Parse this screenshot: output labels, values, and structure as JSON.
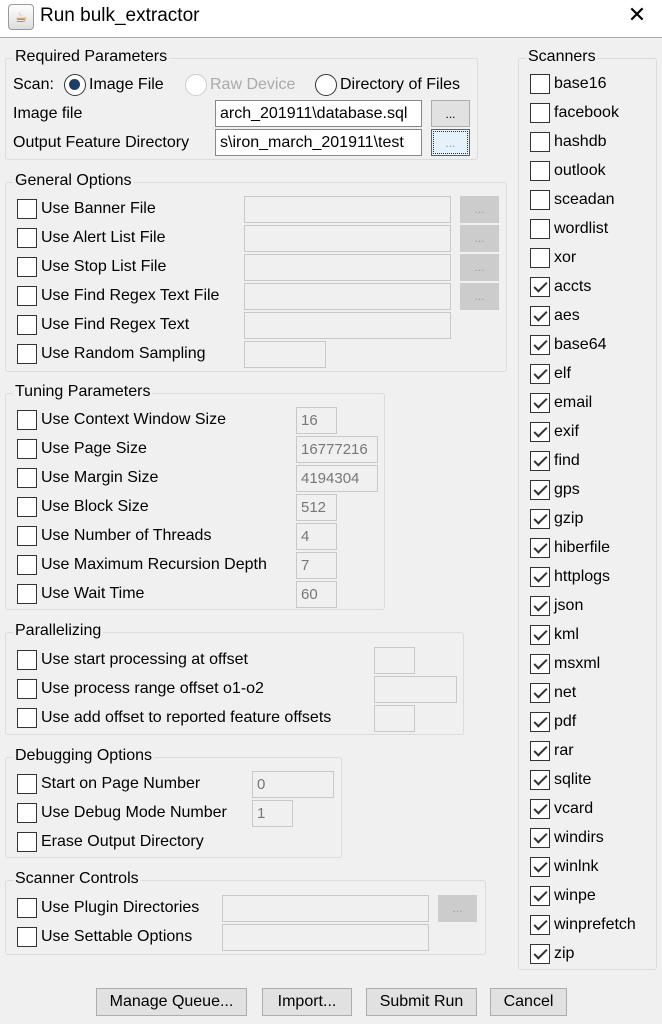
{
  "window": {
    "title": "Run bulk_extractor",
    "close": "✕"
  },
  "required": {
    "title": "Required Parameters",
    "scan_label": "Scan:",
    "scan_options": [
      {
        "label": "Image File",
        "selected": true,
        "enabled": true
      },
      {
        "label": "Raw Device",
        "selected": false,
        "enabled": false
      },
      {
        "label": "Directory of Files",
        "selected": false,
        "enabled": true
      }
    ],
    "image_file_label": "Image file",
    "image_file_value": "arch_201911\\database.sql",
    "output_label": "Output Feature Directory",
    "output_value": "s\\iron_march_201911\\test",
    "browse": "..."
  },
  "general": {
    "title": "General Options",
    "items": [
      {
        "label": "Use Banner File",
        "value": "",
        "browse": "..."
      },
      {
        "label": "Use Alert List File",
        "value": "",
        "browse": "..."
      },
      {
        "label": "Use Stop List File",
        "value": "",
        "browse": "..."
      },
      {
        "label": "Use Find Regex Text File",
        "value": "",
        "browse": "..."
      },
      {
        "label": "Use Find Regex Text",
        "value": ""
      },
      {
        "label": "Use Random Sampling",
        "value": ""
      }
    ]
  },
  "tuning": {
    "title": "Tuning Parameters",
    "items": [
      {
        "label": "Use Context Window Size",
        "value": "16"
      },
      {
        "label": "Use Page Size",
        "value": "16777216"
      },
      {
        "label": "Use Margin Size",
        "value": "4194304"
      },
      {
        "label": "Use Block Size",
        "value": "512"
      },
      {
        "label": "Use Number of Threads",
        "value": "4"
      },
      {
        "label": "Use Maximum Recursion Depth",
        "value": "7"
      },
      {
        "label": "Use Wait Time",
        "value": "60"
      }
    ]
  },
  "parallel": {
    "title": "Parallelizing",
    "items": [
      {
        "label": "Use start processing at offset",
        "value": ""
      },
      {
        "label": "Use process range offset o1-o2",
        "value": ""
      },
      {
        "label": "Use add offset to reported feature offsets",
        "value": ""
      }
    ]
  },
  "debug": {
    "title": "Debugging Options",
    "items": [
      {
        "label": "Start on Page Number",
        "value": "0"
      },
      {
        "label": "Use Debug Mode Number",
        "value": "1"
      },
      {
        "label": "Erase Output Directory"
      }
    ]
  },
  "controls": {
    "title": "Scanner Controls",
    "items": [
      {
        "label": "Use Plugin Directories",
        "value": "",
        "browse": "..."
      },
      {
        "label": "Use Settable Options",
        "value": ""
      }
    ]
  },
  "scanners": {
    "title": "Scanners",
    "items": [
      {
        "label": "base16",
        "checked": false
      },
      {
        "label": "facebook",
        "checked": false
      },
      {
        "label": "hashdb",
        "checked": false
      },
      {
        "label": "outlook",
        "checked": false
      },
      {
        "label": "sceadan",
        "checked": false
      },
      {
        "label": "wordlist",
        "checked": false
      },
      {
        "label": "xor",
        "checked": false
      },
      {
        "label": "accts",
        "checked": true
      },
      {
        "label": "aes",
        "checked": true
      },
      {
        "label": "base64",
        "checked": true
      },
      {
        "label": "elf",
        "checked": true
      },
      {
        "label": "email",
        "checked": true
      },
      {
        "label": "exif",
        "checked": true
      },
      {
        "label": "find",
        "checked": true
      },
      {
        "label": "gps",
        "checked": true
      },
      {
        "label": "gzip",
        "checked": true
      },
      {
        "label": "hiberfile",
        "checked": true
      },
      {
        "label": "httplogs",
        "checked": true
      },
      {
        "label": "json",
        "checked": true
      },
      {
        "label": "kml",
        "checked": true
      },
      {
        "label": "msxml",
        "checked": true
      },
      {
        "label": "net",
        "checked": true
      },
      {
        "label": "pdf",
        "checked": true
      },
      {
        "label": "rar",
        "checked": true
      },
      {
        "label": "sqlite",
        "checked": true
      },
      {
        "label": "vcard",
        "checked": true
      },
      {
        "label": "windirs",
        "checked": true
      },
      {
        "label": "winlnk",
        "checked": true
      },
      {
        "label": "winpe",
        "checked": true
      },
      {
        "label": "winprefetch",
        "checked": true
      },
      {
        "label": "zip",
        "checked": true
      }
    ]
  },
  "buttons": {
    "manage_queue": "Manage Queue...",
    "import": "Import...",
    "submit": "Submit Run",
    "cancel": "Cancel"
  }
}
